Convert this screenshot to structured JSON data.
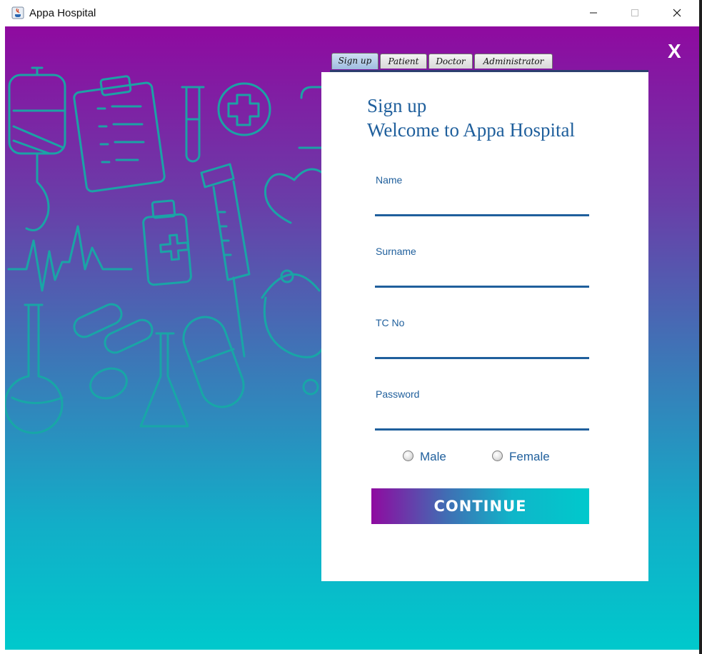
{
  "window": {
    "title": "Appa Hospital"
  },
  "close_label": "X",
  "tabs": [
    {
      "label": "Sign up",
      "active": true
    },
    {
      "label": "Patient",
      "active": false
    },
    {
      "label": "Doctor",
      "active": false
    },
    {
      "label": "Administrator",
      "active": false
    }
  ],
  "form": {
    "heading_line1": "Sign up",
    "heading_line2": "Welcome to Appa Hospital",
    "fields": [
      {
        "label": "Name",
        "value": ""
      },
      {
        "label": "Surname",
        "value": ""
      },
      {
        "label": "TC No",
        "value": ""
      },
      {
        "label": "Password",
        "value": ""
      }
    ],
    "gender_options": [
      {
        "label": "Male",
        "selected": false
      },
      {
        "label": "Female",
        "selected": false
      }
    ],
    "continue_label": "CONTINUE"
  },
  "colors": {
    "accent": "#1f5f9c",
    "gradient_top": "#8f0aa0",
    "gradient_bottom": "#00c9cc",
    "doodle": "#17a9a6"
  }
}
